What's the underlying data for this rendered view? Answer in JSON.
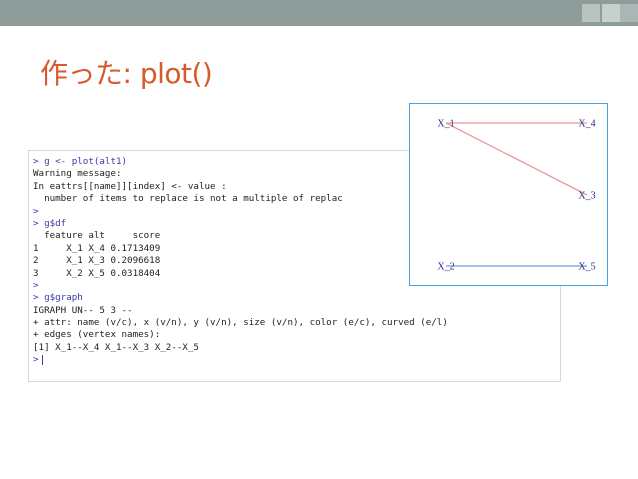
{
  "slide": {
    "title": "作った: plot()"
  },
  "console": {
    "lines": [
      {
        "type": "cmd",
        "text": "> g <- plot(alt1)"
      },
      {
        "type": "out",
        "text": "Warning message:"
      },
      {
        "type": "out",
        "text": "In eattrs[[name]][index] <- value :"
      },
      {
        "type": "out",
        "text": "  number of items to replace is not a multiple of replac"
      },
      {
        "type": "cmd",
        "text": ">"
      },
      {
        "type": "cmd",
        "text": "> g$df"
      },
      {
        "type": "out",
        "text": "  feature alt     score"
      },
      {
        "type": "out",
        "text": "1     X_1 X_4 0.1713409"
      },
      {
        "type": "out",
        "text": "2     X_1 X_3 0.2096618"
      },
      {
        "type": "out",
        "text": "3     X_2 X_5 0.0318404"
      },
      {
        "type": "cmd",
        "text": ">"
      },
      {
        "type": "cmd",
        "text": "> g$graph"
      },
      {
        "type": "out",
        "text": "IGRAPH UN-- 5 3 --"
      },
      {
        "type": "out",
        "text": "+ attr: name (v/c), x (v/n), y (v/n), size (v/n), color (e/c), curved (e/l)"
      },
      {
        "type": "out",
        "text": "+ edges (vertex names):"
      },
      {
        "type": "out",
        "text": "[1] X_1--X_4 X_1--X_3 X_2--X_5"
      },
      {
        "type": "prompt",
        "text": ">"
      }
    ]
  },
  "graph_plot": {
    "vertices": [
      {
        "name": "X_1"
      },
      {
        "name": "X_4"
      },
      {
        "name": "X_3"
      },
      {
        "name": "X_2"
      },
      {
        "name": "X_5"
      }
    ],
    "edges": [
      {
        "from": "X_1",
        "to": "X_4",
        "color": "#e89a9a"
      },
      {
        "from": "X_1",
        "to": "X_3",
        "color": "#e89a9a"
      },
      {
        "from": "X_2",
        "to": "X_5",
        "color": "#6a9fd4"
      }
    ]
  },
  "colors": {
    "title": "#d65a2b",
    "topbar": "#8f9d9a",
    "plot_border": "#4aa3df",
    "vertex_label": "#2b2b8a"
  }
}
